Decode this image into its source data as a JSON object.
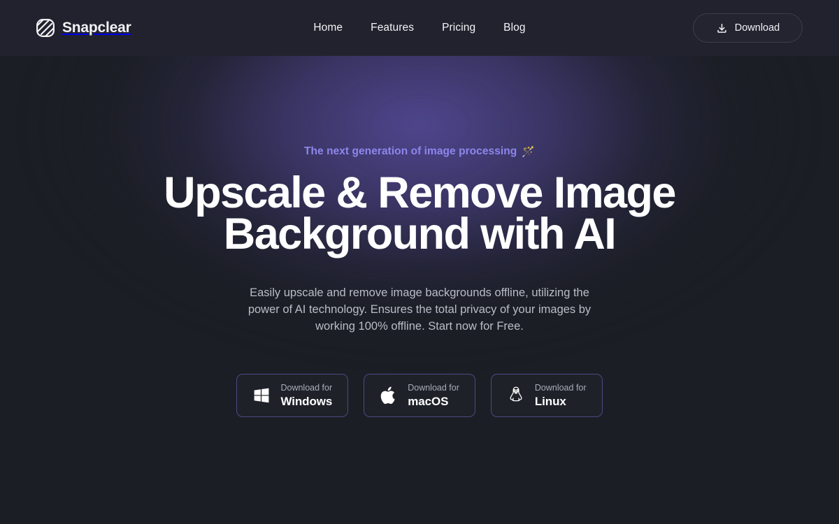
{
  "brand": {
    "name": "Snapclear",
    "logo_icon": "striped-rounded-square-logo"
  },
  "header": {
    "nav": [
      {
        "label": "Home",
        "name": "home"
      },
      {
        "label": "Features",
        "name": "features"
      },
      {
        "label": "Pricing",
        "name": "pricing"
      },
      {
        "label": "Blog",
        "name": "blog"
      }
    ],
    "cta": {
      "label": "Download",
      "icon": "download-icon"
    },
    "background_color": "#21222e"
  },
  "hero": {
    "eyebrow": {
      "text": "The next generation of image processing",
      "emoji": "🪄",
      "emoji_name": "magic-wand-emoji",
      "color": "#8e86ec"
    },
    "headline": "Upscale & Remove Image Background with AI",
    "subheadline": "Easily upscale and remove image backgrounds offline, utilizing the power of AI technology. Ensures the total privacy of your images by working 100% offline. Start now for Free.",
    "glow_color": "#534996",
    "background_color": "#1b1e24",
    "download_buttons": [
      {
        "pre_label": "Download for",
        "os": "Windows",
        "icon": "windows-icon"
      },
      {
        "pre_label": "Download for",
        "os": "macOS",
        "icon": "apple-icon"
      },
      {
        "pre_label": "Download for",
        "os": "Linux",
        "icon": "linux-tux-icon"
      }
    ],
    "button_border_color": "#4e4885"
  }
}
